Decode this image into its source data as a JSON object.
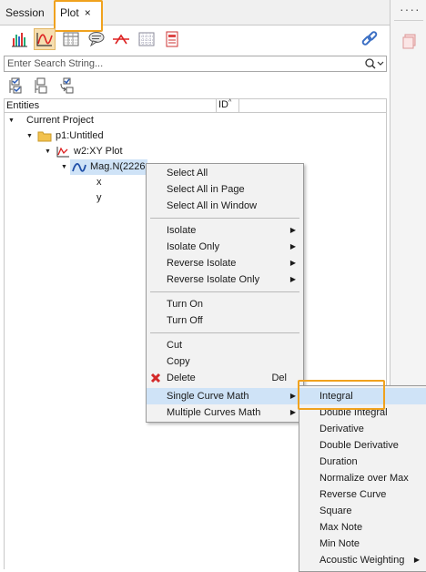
{
  "tabs": {
    "session": "Session",
    "plot": "Plot",
    "close": "×"
  },
  "right_strip": {
    "dots": "····"
  },
  "toolbar_icons": [
    "bar-chart-icon",
    "curve-icon",
    "table-icon",
    "note-icon",
    "line-icon",
    "grid-icon",
    "page-icon",
    "link-icon"
  ],
  "search": {
    "placeholder": "Enter Search String..."
  },
  "columns": {
    "entities": "Entities",
    "id": "ID"
  },
  "tree": {
    "project": "Current Project",
    "page": "p1:Untitled",
    "plot": "w2:XY Plot",
    "curve": "Mag.N(2226",
    "x": "x",
    "y": "y"
  },
  "context_menu": {
    "select_all": "Select All",
    "select_all_page": "Select All in Page",
    "select_all_window": "Select All in Window",
    "isolate": "Isolate",
    "isolate_only": "Isolate Only",
    "reverse_isolate": "Reverse Isolate",
    "reverse_isolate_only": "Reverse Isolate Only",
    "turn_on": "Turn On",
    "turn_off": "Turn Off",
    "cut": "Cut",
    "copy": "Copy",
    "delete": "Delete",
    "delete_shortcut": "Del",
    "single_curve_math": "Single Curve Math",
    "multiple_curves_math": "Multiple Curves Math"
  },
  "submenu": {
    "integral": "Integral",
    "double_integral": "Double Integral",
    "derivative": "Derivative",
    "double_derivative": "Double Derivative",
    "duration": "Duration",
    "normalize_over_max": "Normalize over Max",
    "reverse_curve": "Reverse Curve",
    "square": "Square",
    "max_note": "Max Note",
    "min_note": "Min Note",
    "acoustic_weighting": "Acoustic Weighting"
  },
  "colors": {
    "highlight": "#f0a21e",
    "selection": "#cfe3f7",
    "menu_bg": "#f2f2f2"
  }
}
